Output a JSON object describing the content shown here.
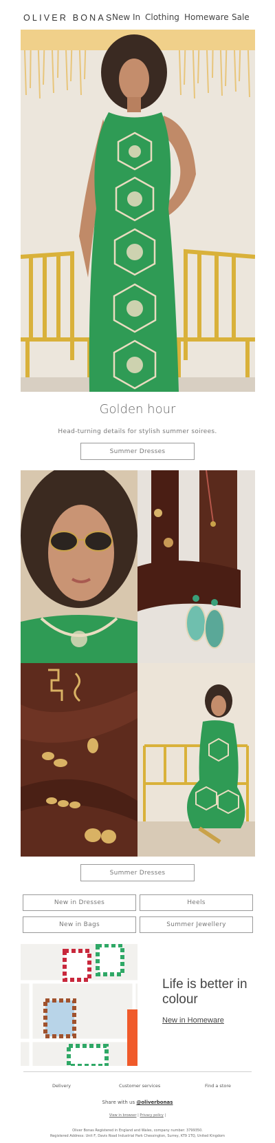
{
  "header": {
    "logo": "OLIVER BONAS",
    "nav": [
      "New In",
      "Clothing",
      "Homeware",
      "Sale"
    ]
  },
  "hero": {
    "title": "Golden hour",
    "subtitle": "Head-turning details for stylish summer soirees.",
    "button": "Summer Dresses"
  },
  "grid": {
    "button": "Summer Dresses"
  },
  "categories": [
    "New in Dresses",
    "Heels",
    "New in Bags",
    "Summer Jewellery"
  ],
  "promo": {
    "title": "Life is better in colour",
    "link": "New in Homeware"
  },
  "footer": {
    "links": [
      "Delivery",
      "Customer services",
      "Find a store"
    ],
    "share_prefix": "Share with us",
    "share_handle": "@oliverbonas",
    "view_in_browser": "View in browser",
    "separator": "|",
    "privacy": "Privacy policy",
    "legal_line1": "Oliver Bonas Registered in England and Wales, company number: 3799350.",
    "legal_line2": "Registered Address: Unit F, Davis Road Industrial Park Chessington, Surrey, KT9 1TQ, United Kingdom"
  },
  "colors": {
    "dress_green": "#2f9b55",
    "chair_yellow": "#d9b13a",
    "backdrop_brown": "#5a2a1c"
  }
}
